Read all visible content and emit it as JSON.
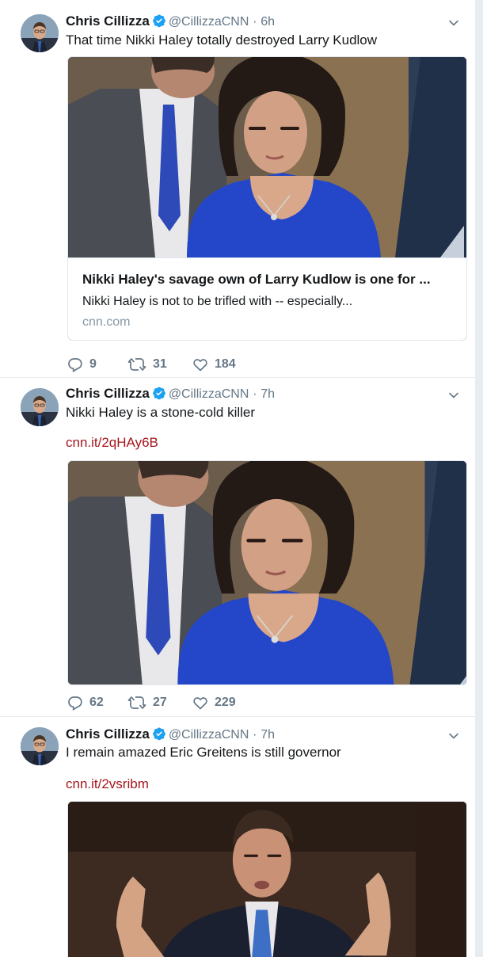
{
  "tweets": [
    {
      "author": {
        "name": "Chris Cillizza",
        "handle": "@CillizzaCNN",
        "time": "6h",
        "separator": "·"
      },
      "text": "That time Nikki Haley totally destroyed Larry Kudlow",
      "card": {
        "title": "Nikki Haley's savage own of Larry Kudlow is one for ...",
        "description": "Nikki Haley is not to be trifled with -- especially...",
        "domain": "cnn.com"
      },
      "actions": {
        "replies": "9",
        "retweets": "31",
        "likes": "184"
      }
    },
    {
      "author": {
        "name": "Chris Cillizza",
        "handle": "@CillizzaCNN",
        "time": "7h",
        "separator": "·"
      },
      "text": "Nikki Haley is a stone-cold killer",
      "link": "cnn.it/2qHAy6B",
      "actions": {
        "replies": "62",
        "retweets": "27",
        "likes": "229"
      }
    },
    {
      "author": {
        "name": "Chris Cillizza",
        "handle": "@CillizzaCNN",
        "time": "7h",
        "separator": "·"
      },
      "text": "I remain amazed Eric Greitens is still governor",
      "link": "cnn.it/2vsribm"
    }
  ],
  "icons": {
    "verified": "verified-badge-icon",
    "caret": "chevron-down-icon",
    "reply": "reply-icon",
    "retweet": "retweet-icon",
    "like": "heart-icon"
  },
  "colors": {
    "link": "#a7161d",
    "secondary": "#657786",
    "verified": "#1da1f2",
    "border": "#e6ecf0"
  }
}
